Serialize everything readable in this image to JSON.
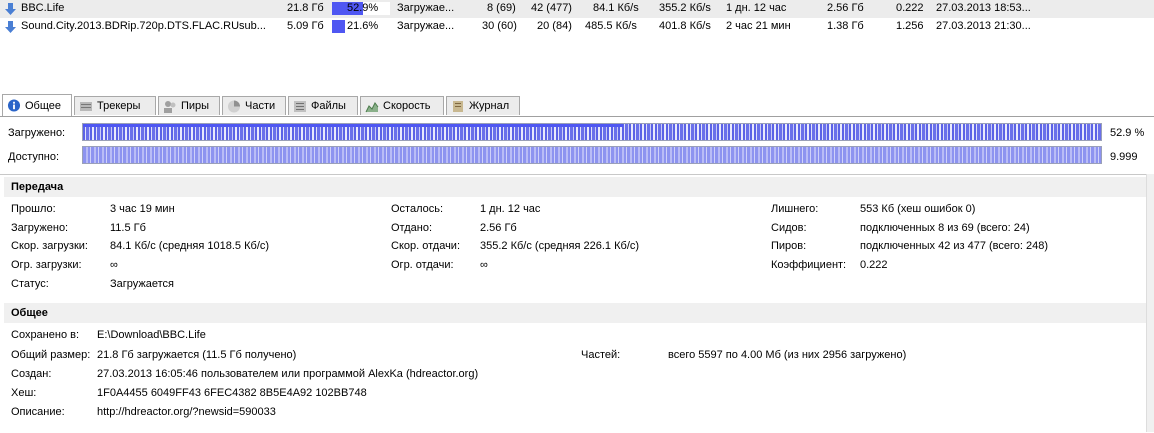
{
  "torrents": [
    {
      "name": "BBC.Life",
      "size": "21.8 Гб",
      "progress_pct": 52.9,
      "progress_label": "52.9%",
      "status": "Загружае...",
      "seeds": "8 (69)",
      "peers": "42 (477)",
      "down": "84.1 Кб/s",
      "up": "355.2 Кб/s",
      "eta": "1 дн. 12 час",
      "uploaded": "2.56 Гб",
      "ratio": "0.222",
      "added": "27.03.2013 18:53..."
    },
    {
      "name": "Sound.City.2013.BDRip.720p.DTS.FLAC.RUsub...",
      "size": "5.09 Гб",
      "progress_pct": 21.6,
      "progress_label": "21.6%",
      "status": "Загружае...",
      "seeds": "30 (60)",
      "peers": "20 (84)",
      "down": "485.5 Кб/s",
      "up": "401.8 Кб/s",
      "eta": "2 час 21 мин",
      "uploaded": "1.38 Гб",
      "ratio": "1.256",
      "added": "27.03.2013 21:30..."
    }
  ],
  "tabs": [
    {
      "label": "Общее",
      "icon": "info-icon"
    },
    {
      "label": "Трекеры",
      "icon": "trackers-icon"
    },
    {
      "label": "Пиры",
      "icon": "peers-icon"
    },
    {
      "label": "Части",
      "icon": "pieces-icon"
    },
    {
      "label": "Файлы",
      "icon": "files-icon"
    },
    {
      "label": "Скорость",
      "icon": "speed-icon"
    },
    {
      "label": "Журнал",
      "icon": "log-icon"
    }
  ],
  "bars": {
    "downloaded": {
      "label": "Загружено:",
      "value": "52.9 %",
      "fraction": 0.529
    },
    "available": {
      "label": "Доступно:",
      "value": "9.999"
    }
  },
  "transfer": {
    "title": "Передача",
    "col1": [
      {
        "label": "Прошло:",
        "value": "3 час 19 мин"
      },
      {
        "label": "Загружено:",
        "value": "11.5 Гб"
      },
      {
        "label": "Скор. загрузки:",
        "value": "84.1 Кб/с (средняя 1018.5 Кб/с)"
      },
      {
        "label": "Огр. загрузки:",
        "value": "∞"
      },
      {
        "label": "Статус:",
        "value": "Загружается"
      }
    ],
    "col2": [
      {
        "label": "Осталось:",
        "value": "1 дн. 12 час"
      },
      {
        "label": "Отдано:",
        "value": "2.56 Гб"
      },
      {
        "label": "Скор. отдачи:",
        "value": "355.2 Кб/с (средняя 226.1 Кб/с)"
      },
      {
        "label": "Огр. отдачи:",
        "value": "∞"
      }
    ],
    "col3": [
      {
        "label": "Лишнего:",
        "value": "553 Кб (хеш ошибок 0)"
      },
      {
        "label": "Сидов:",
        "value": "подключенных 8 из 69 (всего: 24)"
      },
      {
        "label": "Пиров:",
        "value": "подключенных 42 из 477 (всего: 248)"
      },
      {
        "label": "Коэффициент:",
        "value": "0.222"
      }
    ]
  },
  "general": {
    "title": "Общее",
    "saved_label": "Сохранено в:",
    "saved_value": "E:\\Download\\BBC.Life",
    "size_label": "Общий размер:",
    "size_value": "21.8 Гб загружается (11.5 Гб получено)",
    "pieces_label": "Частей:",
    "pieces_value": "всего 5597 по 4.00 Мб (из них 2956 загружено)",
    "created_label": "Создан:",
    "created_value": "27.03.2013 16:05:46 пользователем или программой AlexKa (hdreactor.org)",
    "hash_label": "Хеш:",
    "hash_value": "1F0A4455 6049FF43 6FEC4382 8B5E4A92 102BB748",
    "desc_label": "Описание:",
    "desc_value": "http://hdreactor.org/?newsid=590033"
  },
  "colors": {
    "progress": "#4f57f2",
    "selected_row": "#ececec",
    "section_bg": "#f0f0f0"
  }
}
